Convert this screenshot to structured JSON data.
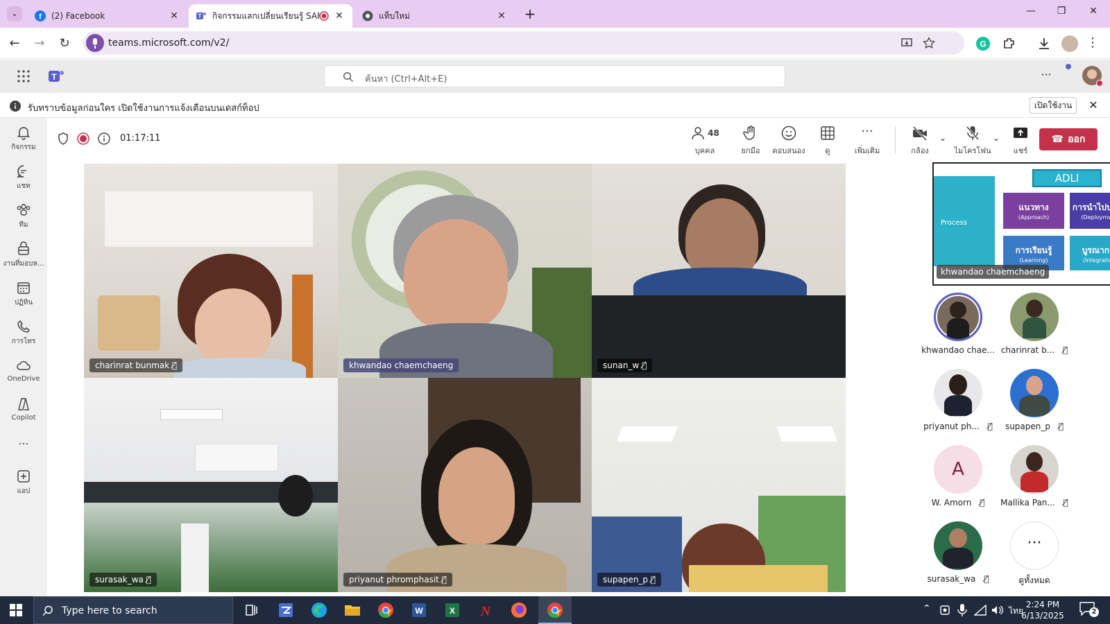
{
  "browser": {
    "tabs": [
      {
        "title": "(2) Facebook",
        "close": "✕"
      },
      {
        "title": "กิจกรรมแลกเปลี่ยนเรียนรู้ SAR -",
        "close": "✕"
      },
      {
        "title": "แท็บใหม่",
        "close": "✕"
      }
    ],
    "new_tab": "+",
    "url": "teams.microsoft.com/v2/",
    "window_controls": [
      "—",
      "❐",
      "✕"
    ]
  },
  "teams": {
    "search_placeholder": "ค้นหา (Ctrl+Alt+E)",
    "notification": {
      "text": "รับทราบข้อมูลก่อนใคร เปิดใช้งานการแจ้งเตือนบนเดสก์ท็อป",
      "button": "เปิดใช้งาน",
      "close": "✕"
    },
    "rail": [
      {
        "label": "กิจกรรม",
        "icon": "bell-icon"
      },
      {
        "label": "แชท",
        "icon": "chat-icon"
      },
      {
        "label": "ทีม",
        "icon": "teams-icon"
      },
      {
        "label": "งานที่มอบห...",
        "icon": "assignments-icon"
      },
      {
        "label": "ปฏิทิน",
        "icon": "calendar-icon"
      },
      {
        "label": "การโทร",
        "icon": "phone-icon"
      },
      {
        "label": "OneDrive",
        "icon": "cloud-icon"
      },
      {
        "label": "Copilot",
        "icon": "copilot-icon"
      },
      {
        "label": "...",
        "icon": "more-icon"
      },
      {
        "label": "แอป",
        "icon": "apps-icon"
      }
    ]
  },
  "meeting": {
    "timer": "01:17:11",
    "controls": {
      "people_count": "48",
      "people_label": "บุคคล",
      "raise_label": "ยกมือ",
      "react_label": "ตอบสนอง",
      "view_label": "ดู",
      "more_label": "เพิ่มเติม",
      "camera_label": "กล้อง",
      "mic_label": "ไมโครโฟน",
      "share_label": "แชร์",
      "leave_label": "ออก"
    },
    "tiles": [
      {
        "name": "charinrat bunmak",
        "muted": true
      },
      {
        "name": "khwandao chaemchaeng",
        "muted": false
      },
      {
        "name": "sunan_w",
        "muted": true
      },
      {
        "name": "surasak_wa",
        "muted": true
      },
      {
        "name": "priyanut phromphasit",
        "muted": true
      },
      {
        "name": "supapen_p",
        "muted": true
      }
    ],
    "shared_screen": {
      "presenter": "khwandao chaemchaeng",
      "title": "ADLI",
      "left_text": "Process",
      "boxes": [
        {
          "label": "แนวทาง",
          "sub": "(Approach)",
          "color": "#7b3fa0"
        },
        {
          "label": "การนำไปปฏิบัติ",
          "sub": "(Deployment)",
          "color": "#4b3ca8"
        },
        {
          "label": "การเรียนรู้",
          "sub": "(Learning)",
          "color": "#3a7bc8"
        },
        {
          "label": "บูรณาการ",
          "sub": "(Integration)",
          "color": "#29a9c9"
        }
      ]
    },
    "participants": [
      {
        "name": "khwandao chae...",
        "muted": false,
        "speaking": true
      },
      {
        "name": "charinrat b...",
        "muted": true
      },
      {
        "name": "priyanut ph...",
        "muted": true
      },
      {
        "name": "supapen_p",
        "muted": true
      },
      {
        "name": "W. Amorn",
        "muted": true,
        "initial": "A"
      },
      {
        "name": "Mallika Pan...",
        "muted": true
      },
      {
        "name": "surasak_wa",
        "muted": true
      },
      {
        "name": "ดูทั้งหมด",
        "more": "···"
      }
    ]
  },
  "taskbar": {
    "search_placeholder": "Type here to search",
    "time": "2:24 PM",
    "date": "6/13/2025",
    "lang": "ไทย",
    "notifications": "2"
  }
}
